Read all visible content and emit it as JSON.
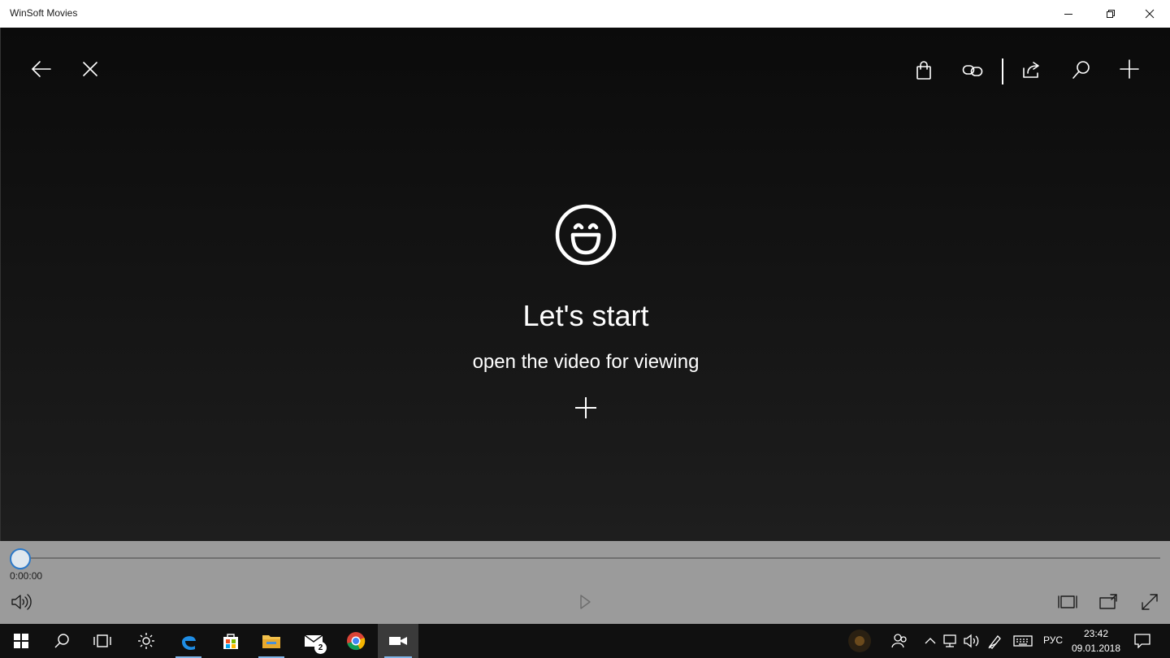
{
  "window": {
    "title": "WinSoft Movies",
    "controls": [
      "minimize-icon",
      "restore-icon",
      "close-icon"
    ]
  },
  "toolbar": {
    "left": [
      "back-arrow-icon",
      "close-icon"
    ],
    "right": [
      "shopping-bag-icon",
      "link-icon",
      "share-icon",
      "search-icon",
      "add-icon"
    ]
  },
  "empty_state": {
    "icon": "laughing-face-icon",
    "headline": "Let's start",
    "subline": "open the video for viewing",
    "action_icon": "add-icon"
  },
  "player": {
    "progress_fraction": 0,
    "time": "0:00:00",
    "buttons": [
      "volume-icon",
      "play-icon",
      "aspect-ratio-icon",
      "picture-in-picture-icon",
      "fullscreen-icon"
    ],
    "accent": "#2b78c8"
  },
  "taskbar": {
    "pinned": [
      "windows-start-icon",
      "search-icon",
      "task-view-icon",
      "settings-sun-icon",
      "edge-icon",
      "store-icon",
      "file-explorer-icon",
      "mail-icon",
      "chrome-icon",
      "movies-camera-icon"
    ],
    "mail_badge": "2",
    "language": "РУС",
    "time": "23:42",
    "date": "09.01.2018",
    "tray_icons": [
      "people-icon",
      "chevron-up-icon",
      "network-icon",
      "volume-icon",
      "pen-icon",
      "keyboard-icon",
      "notifications-icon"
    ]
  }
}
